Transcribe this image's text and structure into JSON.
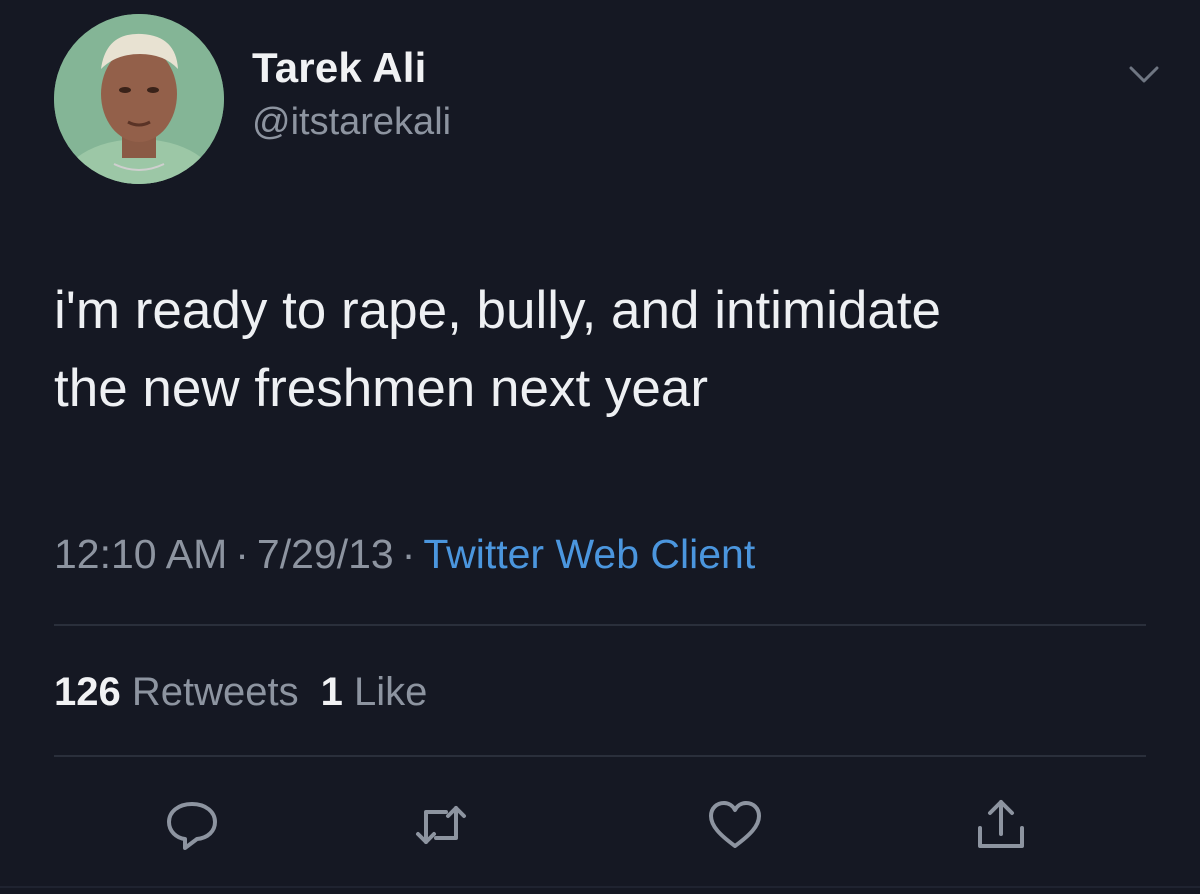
{
  "author": {
    "display_name": "Tarek Ali",
    "handle": "@itstarekali"
  },
  "tweet": {
    "line1": "i'm ready to rape, bully, and intimidate",
    "line2": "the new freshmen next year"
  },
  "meta": {
    "time": "12:10 AM",
    "separator": "·",
    "date": "7/29/13",
    "client": "Twitter Web Client"
  },
  "stats": {
    "retweets_count": "126",
    "retweets_label": "Retweets",
    "likes_count": "1",
    "likes_label": "Like"
  },
  "icons": {
    "menu": "chevron-down-icon",
    "reply": "reply-icon",
    "retweet": "retweet-icon",
    "like": "heart-icon",
    "share": "share-icon"
  },
  "colors": {
    "background": "#151823",
    "link": "#4b96de",
    "muted": "#8d94a0",
    "text": "#eef0f3"
  }
}
